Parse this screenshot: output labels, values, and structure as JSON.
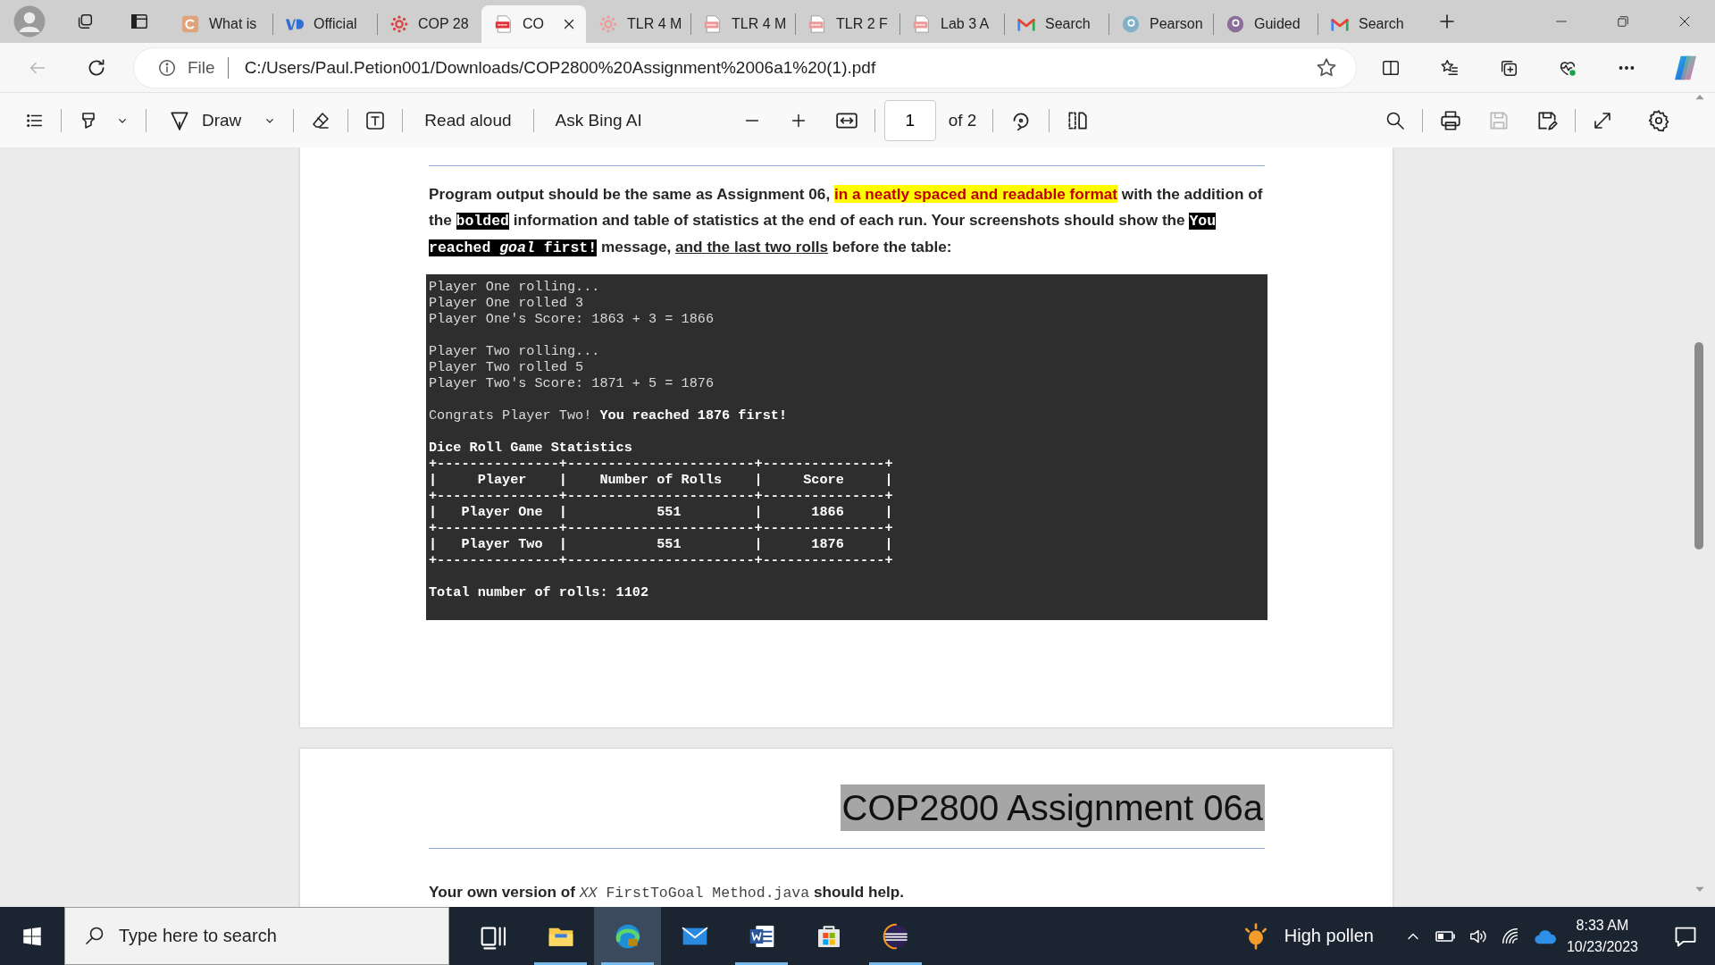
{
  "tabs": [
    {
      "label": "What is",
      "selected": false,
      "kind": "app",
      "color": "#e0a47c"
    },
    {
      "label": "Official",
      "selected": false,
      "kind": "logo",
      "color": "#2f6fd6"
    },
    {
      "label": "COP 28",
      "selected": false,
      "kind": "wheel",
      "color": "#d9453e"
    },
    {
      "label": "CO",
      "selected": true,
      "kind": "pdf",
      "color": "#e0323a"
    },
    {
      "label": "TLR 4 M",
      "selected": false,
      "kind": "wheel",
      "color": "#eaa09a"
    },
    {
      "label": "TLR 4 M",
      "selected": false,
      "kind": "pdf",
      "color": "#eb9a9c"
    },
    {
      "label": "TLR 2 F",
      "selected": false,
      "kind": "pdf",
      "color": "#eb9a9c"
    },
    {
      "label": "Lab 3 A",
      "selected": false,
      "kind": "pdf",
      "color": "#eb9a9c"
    },
    {
      "label": "Search",
      "selected": false,
      "kind": "mail",
      "color": "#ea4335"
    },
    {
      "label": "Pearson",
      "selected": false,
      "kind": "circle",
      "color": "#80b1c6"
    },
    {
      "label": "Guided",
      "selected": false,
      "kind": "circle",
      "color": "#8c6c98"
    },
    {
      "label": "Search",
      "selected": false,
      "kind": "mail",
      "color": "#ea4335"
    }
  ],
  "navigation": {
    "back_enabled": false
  },
  "address_bar": {
    "scheme": "File",
    "url": "C:/Users/Paul.Petion001/Downloads/COP2800%20Assignment%2006a1%20(1).pdf"
  },
  "pdf_toolbar": {
    "draw": "Draw",
    "read_aloud": "Read aloud",
    "ask_ai": "Ask Bing AI",
    "page": "1",
    "page_count": "of 2",
    "save_enabled": false
  },
  "page_1": {
    "paragraph": [
      {
        "kind": "plain",
        "text": "Program output should be the same as Assignment 06, "
      },
      {
        "kind": "highlight",
        "text": "in a neatly spaced and readable format"
      },
      {
        "kind": "plain",
        "text": " with the addition of the "
      },
      {
        "kind": "code",
        "text": "bolded"
      },
      {
        "kind": "plain",
        "text": " information and table of statistics at the end of each run. Your screenshots should show the "
      },
      {
        "kind": "code",
        "text": "You reached *goal* first!"
      },
      {
        "kind": "plain",
        "text": " message, "
      },
      {
        "kind": "underline",
        "text": "and the last two rolls"
      },
      {
        "kind": "plain",
        "text": " before the table:"
      }
    ],
    "console": [
      [
        {
          "text": "Player One rolling...",
          "bold": false
        },
        {
          "text": "Player One rolled 3",
          "bold": false
        },
        {
          "text": "Player One's Score: 1863 + 3 = 1866",
          "bold": false
        }
      ],
      [
        {
          "text": "Player Two rolling...",
          "bold": false
        },
        {
          "text": "Player Two rolled 5",
          "bold": false
        },
        {
          "text": "Player Two's Score: 1871 + 5 = 1876",
          "bold": false
        }
      ],
      [
        {
          "text": "Congrats Player Two! **You reached 1876 first!**",
          "bold": false
        }
      ],
      [
        {
          "text": "Dice Roll Game Statistics",
          "bold": true
        },
        {
          "text": "+---------------+-----------------------+---------------+",
          "bold": true
        },
        {
          "text": "|     Player    |    Number of Rolls    |     Score     |",
          "bold": true
        },
        {
          "text": "+---------------+-----------------------+---------------+",
          "bold": true
        },
        {
          "text": "|   Player One  |           551         |      1866     |",
          "bold": true
        },
        {
          "text": "+---------------+-----------------------+---------------+",
          "bold": true
        },
        {
          "text": "|   Player Two  |           551         |      1876     |",
          "bold": true
        },
        {
          "text": "+---------------+-----------------------+---------------+",
          "bold": true
        }
      ],
      [
        {
          "text": "Total number of rolls: 1102",
          "bold": true
        }
      ]
    ]
  },
  "page_2": {
    "title": "COP2800 Assignment 06a",
    "paragraph": [
      {
        "kind": "plain",
        "text": "Your own version of "
      },
      {
        "kind": "mono",
        "text": "*XX* FirstToGoal Method.java"
      },
      {
        "kind": "plain",
        "text": " should help."
      }
    ]
  },
  "taskbar": {
    "search_placeholder": "Type here to search",
    "apps": [
      {
        "kind": "task-view",
        "active": false,
        "running": false
      },
      {
        "kind": "folder",
        "active": false,
        "running": true
      },
      {
        "kind": "browser",
        "active": true,
        "running": true
      },
      {
        "kind": "mail",
        "active": false,
        "running": false
      },
      {
        "kind": "word",
        "active": false,
        "running": true
      },
      {
        "kind": "store",
        "active": false,
        "running": false
      },
      {
        "kind": "eclipse",
        "active": false,
        "running": true
      }
    ],
    "weather": "High pollen",
    "time": "8:33 AM",
    "date": "10/23/2023"
  }
}
